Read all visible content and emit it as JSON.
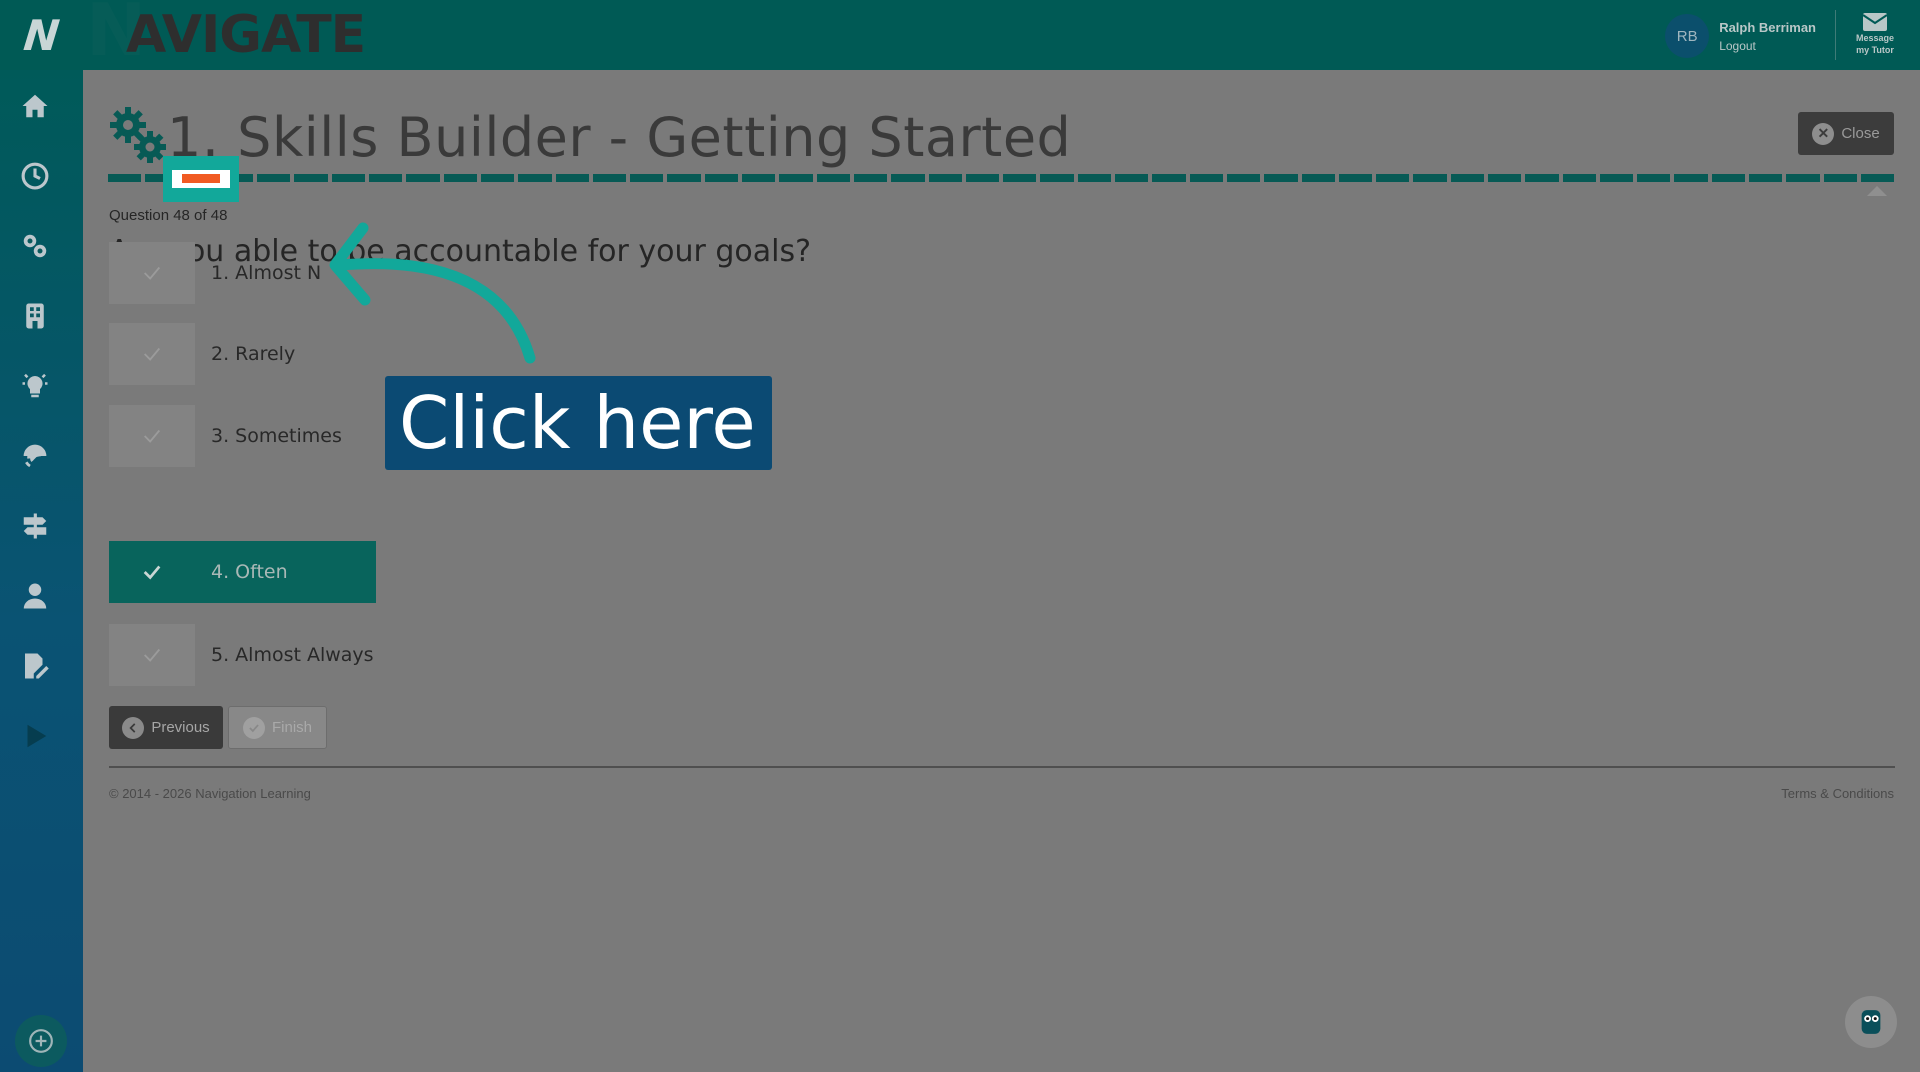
{
  "colors": {
    "topbar": "#005a55",
    "accent": "#08645c",
    "highlight": "#12a89a",
    "callout": "#0b4a73",
    "progress_marker": "#f15a22"
  },
  "header": {
    "logo_mark": "N",
    "logo_word": "AVIGATE",
    "logo_word_big_n": "N",
    "user_initials": "RB",
    "user_name": "Ralph Berriman",
    "logout_label": "Logout",
    "message_label": "Message",
    "message_label_2": "my Tutor"
  },
  "sidebar": {
    "items": [
      {
        "icon": "home-icon"
      },
      {
        "icon": "clock-icon"
      },
      {
        "icon": "gears-icon"
      },
      {
        "icon": "building-icon"
      },
      {
        "icon": "lightbulb-icon"
      },
      {
        "icon": "fingerprint-icon"
      },
      {
        "icon": "signpost-icon"
      },
      {
        "icon": "user-icon"
      },
      {
        "icon": "edit-document-icon"
      },
      {
        "icon": "play-icon"
      }
    ],
    "bottom_icon": "plus-circle-icon"
  },
  "main": {
    "title": "1. Skills Builder - Getting Started",
    "close_label": "Close",
    "progress_segments": 48,
    "question_counter": "Question 48 of 48",
    "question": "Are you able to be accountable for your goals?",
    "options": [
      {
        "label": "1. Almost N",
        "selected": false
      },
      {
        "label": "2. Rarely",
        "selected": false
      },
      {
        "label": "3. Sometimes",
        "selected": false
      },
      {
        "label": "4. Often",
        "selected": true
      },
      {
        "label": "5. Almost Always",
        "selected": false
      }
    ],
    "previous_label": "Previous",
    "finish_label": "Finish"
  },
  "footer": {
    "copyright": "© 2014 - 2026 Navigation Learning",
    "terms": "Terms & Conditions"
  },
  "annotation": {
    "callout_text": "Click here"
  }
}
